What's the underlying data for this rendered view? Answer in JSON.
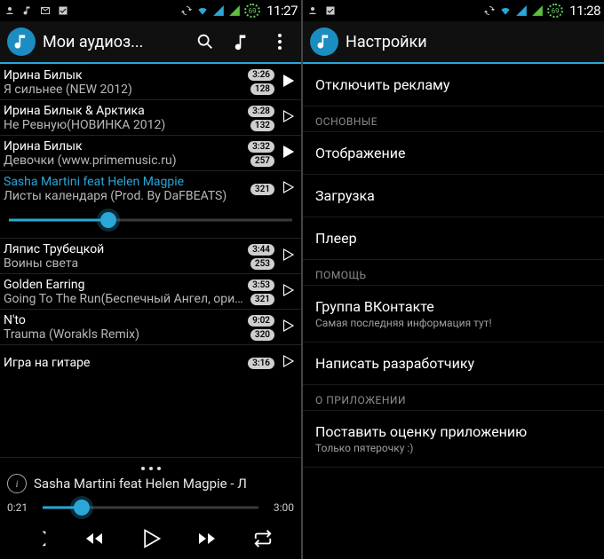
{
  "statusbar": {
    "battery": "69",
    "time_left": "11:27",
    "time_right": "11:28"
  },
  "left": {
    "title": "Мои аудиоз...",
    "tracks": [
      {
        "artist": "Ирина Билык",
        "title": "Я сильнее (NEW 2012)",
        "dur": "3:26",
        "count": "128",
        "playing": true
      },
      {
        "artist": "Ирина Билык & Арктика",
        "title": "Не Ревную(НОВИНКА 2012)",
        "dur": "3:28",
        "count": "132",
        "playing": false
      },
      {
        "artist": "Ирина Билык",
        "title": "Девочки (www.primemusic.ru)",
        "dur": "3:32",
        "count": "257",
        "playing": true
      },
      {
        "artist": "Sasha Martini feat Helen Magpie",
        "title": "Листы календаря (Prod. By DaFBEATS)",
        "dur": "",
        "count": "321",
        "playing": false,
        "active": true
      },
      {
        "artist": "Ляпис Трубецкой",
        "title": "Воины света",
        "dur": "3:44",
        "count": "253",
        "playing": false
      },
      {
        "artist": "Golden Earring",
        "title": "Going To The Run(Беспечный Ангел, оригинал англ.версия)",
        "dur": "3:53",
        "count": "321",
        "playing": false
      },
      {
        "artist": "N'to",
        "title": "Trauma (Worakls Remix)",
        "dur": "9:02",
        "count": "320",
        "playing": false
      },
      {
        "artist": "Игра на гитаре",
        "title": "",
        "dur": "3:16",
        "count": "",
        "playing": false
      }
    ],
    "seek_inline_pct": 35,
    "now_playing": {
      "title": "Sasha Martini feat Helen Magpie - Л",
      "elapsed": "0:21",
      "remaining": "3:00",
      "seek_pct": 18
    }
  },
  "right": {
    "title": "Настройки",
    "items": [
      {
        "kind": "item",
        "primary": "Отключить рекламу"
      },
      {
        "kind": "header",
        "primary": "ОСНОВНЫЕ"
      },
      {
        "kind": "item",
        "primary": "Отображение"
      },
      {
        "kind": "item",
        "primary": "Загрузка"
      },
      {
        "kind": "item",
        "primary": "Плеер"
      },
      {
        "kind": "header",
        "primary": "ПОМОЩЬ"
      },
      {
        "kind": "item",
        "primary": "Группа ВКонтакте",
        "secondary": "Самая последняя информация тут!"
      },
      {
        "kind": "item",
        "primary": "Написать разработчику"
      },
      {
        "kind": "header",
        "primary": "О ПРИЛОЖЕНИИ"
      },
      {
        "kind": "item",
        "primary": "Поставить оценку приложению",
        "secondary": "Только пятерочку :)"
      }
    ]
  }
}
